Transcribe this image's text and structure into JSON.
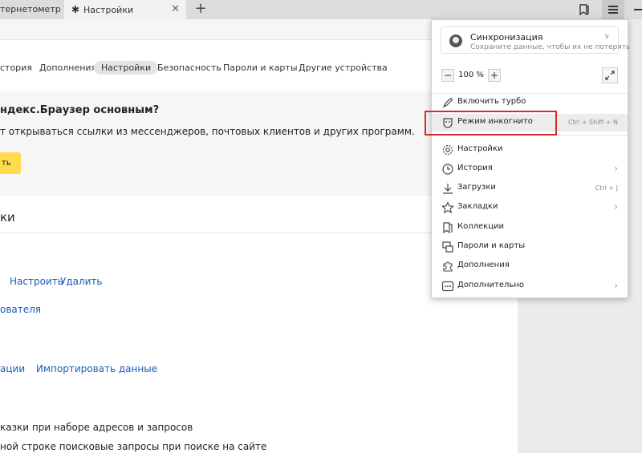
{
  "tabs": {
    "tab1_title": "тернетометр —",
    "tab2_title": "Настройки",
    "tab2_close": "✕",
    "new_tab": "+"
  },
  "settings_nav": [
    {
      "label": "стория"
    },
    {
      "label": "Дополнения"
    },
    {
      "label": "Настройки"
    },
    {
      "label": "Безопасность"
    },
    {
      "label": "Пароли и карты"
    },
    {
      "label": "Другие устройства"
    }
  ],
  "default_card": {
    "title": "ндекс.Браузер основным?",
    "desc": "т открываться ссылки из мессенджеров, почтовых клиентов и других программ.",
    "button": "ть"
  },
  "section": {
    "heading": "ки",
    "configure": "Настроить",
    "delete": "Удалить",
    "user_link": "ователя",
    "sync_link": "ации",
    "import_link": "Импортировать данные",
    "hints_text": "казки при наборе адресов и запросов",
    "search_text": "ной строке поисковые запросы при поиске на сайте"
  },
  "menu": {
    "sync_title": "Синхронизация",
    "sync_sub": "Сохраните данные, чтобы их не потерять",
    "zoom_minus": "−",
    "zoom_value": "100 %",
    "zoom_plus": "+",
    "items": [
      {
        "label": "Включить турбо",
        "shortcut": "",
        "icon": "rocket-icon"
      },
      {
        "label": "Режим инкогнито",
        "shortcut": "Ctrl + Shift + N",
        "icon": "incognito-mask-icon"
      },
      {
        "label": "Настройки",
        "shortcut": "",
        "icon": "gear-icon"
      },
      {
        "label": "История",
        "shortcut": "",
        "icon": "clock-icon"
      },
      {
        "label": "Загрузки",
        "shortcut": "Ctrl + J",
        "icon": "download-icon"
      },
      {
        "label": "Закладки",
        "shortcut": "",
        "icon": "star-icon"
      },
      {
        "label": "Коллекции",
        "shortcut": "",
        "icon": "collections-icon"
      },
      {
        "label": "Пароли и карты",
        "shortcut": "",
        "icon": "passwords-icon"
      },
      {
        "label": "Дополнения",
        "shortcut": "",
        "icon": "puzzle-icon"
      },
      {
        "label": "Дополнительно",
        "shortcut": "",
        "icon": "more-dots-icon"
      }
    ]
  },
  "colors": {
    "highlight_border": "#d42a2a",
    "link": "#1a5bb8",
    "yellow_button": "#ffdb4d"
  }
}
